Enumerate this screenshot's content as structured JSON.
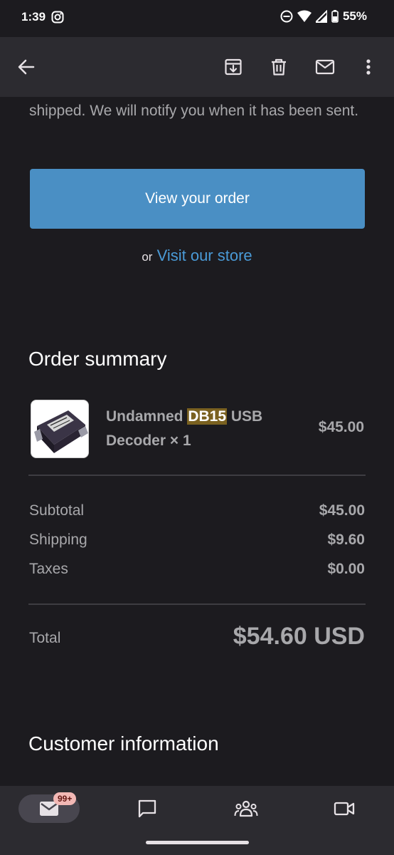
{
  "status_bar": {
    "time": "1:39",
    "battery": "55%"
  },
  "app_bar": {
    "icons": [
      "back-arrow-icon",
      "archive-icon",
      "delete-icon",
      "mark-unread-icon",
      "more-vert-icon"
    ]
  },
  "email": {
    "intro_text": "shipped. We will notify you when it has been sent.",
    "view_order_label": "View your order",
    "or_label": "or",
    "visit_store_label": "Visit our store",
    "order_summary_title": "Order summary",
    "product": {
      "name_before": "Undamned ",
      "name_highlight": "DB15",
      "name_after": " USB Decoder × 1",
      "price": "$45.00",
      "image_icon": "usb-decoder-product-image"
    },
    "totals": {
      "subtotal_label": "Subtotal",
      "subtotal_value": "$45.00",
      "shipping_label": "Shipping",
      "shipping_value": "$9.60",
      "taxes_label": "Taxes",
      "taxes_value": "$0.00",
      "total_label": "Total",
      "total_value": "$54.60 USD"
    },
    "customer_info_title": "Customer information"
  },
  "bottom_nav": {
    "mail_badge": "99+",
    "items": [
      "mail-icon",
      "chat-icon",
      "spaces-icon",
      "meet-icon"
    ]
  },
  "colors": {
    "background": "#1c1b1f",
    "bar": "#2c2b30",
    "button": "#4a8fc4",
    "link": "#4a9ad6",
    "highlight": "#7a6120",
    "badge": "#f2b8b5"
  }
}
